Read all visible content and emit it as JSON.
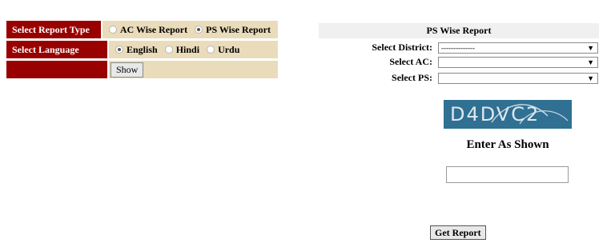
{
  "form": {
    "report_type": {
      "label": "Select Report Type",
      "options": [
        {
          "label": "AC Wise Report",
          "checked": false
        },
        {
          "label": "PS Wise Report",
          "checked": true
        }
      ]
    },
    "language": {
      "label": "Select Language",
      "options": [
        {
          "label": "English",
          "checked": true
        },
        {
          "label": "Hindi",
          "checked": false
        },
        {
          "label": "Urdu",
          "checked": false
        }
      ]
    },
    "show_label": "Show"
  },
  "ps_panel": {
    "title": "PS Wise Report",
    "district": {
      "label": "Select District:",
      "value": "--------------"
    },
    "ac": {
      "label": "Select AC:",
      "value": ""
    },
    "ps": {
      "label": "Select PS:",
      "value": ""
    }
  },
  "captcha": {
    "text": "D4DVC2",
    "prompt": "Enter As Shown",
    "input_value": ""
  },
  "get_report_label": "Get Report",
  "colors": {
    "label_bg": "#990000",
    "value_bg": "#eadcbb",
    "captcha_bg": "#2f7093"
  }
}
